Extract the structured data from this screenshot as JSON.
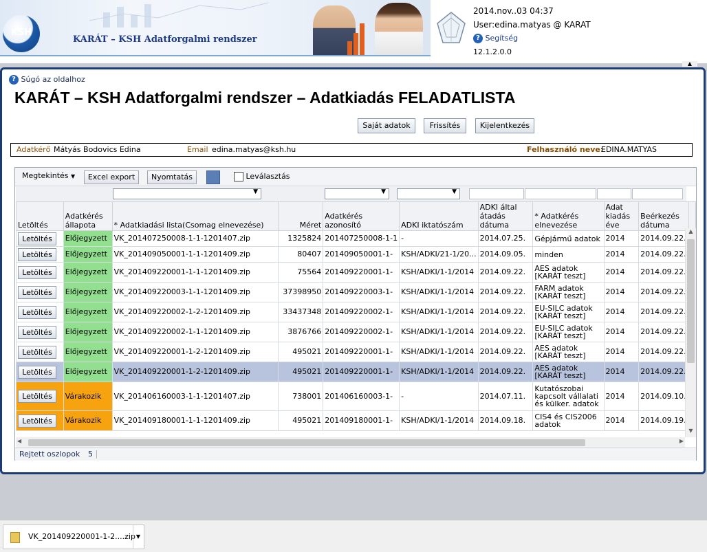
{
  "header": {
    "logo_text": "KSH",
    "banner_title": "KARÁT – KSH Adatforgalmi rendszer",
    "datetime": "2014.nov..03 04:37",
    "user": "User:edina.matyas @ KARAT",
    "help": "Segítség",
    "version": "12.1.2.0.0",
    "karat_logo_label": "KARÁT"
  },
  "page": {
    "help_link": "Súgó az oldalhoz",
    "title": "KARÁT – KSH Adatforgalmi rendszer – Adatkiadás FELADATLISTA",
    "buttons": {
      "own_data": "Saját adatok",
      "refresh": "Frissítés",
      "logout": "Kijelentkezés"
    }
  },
  "userinfo": {
    "requester_label": "Adatkérő",
    "requester": "Mátyás Bodovics Edina",
    "email_label": "Email",
    "email": "edina.matyas@ksh.hu",
    "username_label": "Felhasználó neve:",
    "username": "EDINA.MATYAS"
  },
  "grid": {
    "toolbar": {
      "view": "Megtekintés",
      "excel": "Excel export",
      "print": "Nyomtatás",
      "detach": "Leválasztás"
    },
    "columns": [
      "Letöltés",
      "Adatkérés állapota",
      "* Adatkiadási lista(Csomag elnevezése)",
      "Méret",
      "Adatkérés azonosító",
      "ADKI iktatószám",
      "ADKI által átadás dátuma",
      "* Adatkérés elnevezése",
      "Adat kiadás éve",
      "Beérkezés dátuma"
    ],
    "download_label": "Letöltés",
    "rows": [
      {
        "status": "Előjegyzett",
        "file": "VK_201407250008-1-1-1201407.zip",
        "size": "1325824",
        "req_id": "201407250008-1-1",
        "adki": "-",
        "handover": "2014.07.25.",
        "name": "Gépjármű adatok",
        "year": "2014",
        "arrival": "2014.09.22."
      },
      {
        "status": "Előjegyzett",
        "file": "VK_201409050001-1-1-1201409.zip",
        "size": "80407",
        "req_id": "201409050001-1-",
        "adki": "KSH/ADKI/21-1/20...",
        "handover": "2014.09.05.",
        "name": "minden",
        "year": "2014",
        "arrival": "2014.09.22."
      },
      {
        "status": "Előjegyzett",
        "file": "VK_201409220001-1-1-1201409.zip",
        "size": "75564",
        "req_id": "201409220001-1-",
        "adki": "KSH/ADKI/1-1/2014",
        "handover": "2014.09.22.",
        "name": "AES adatok [KARÁT teszt]",
        "year": "2014",
        "arrival": "2014.09.22."
      },
      {
        "status": "Előjegyzett",
        "file": "VK_201409220003-1-1-1201409.zip",
        "size": "37398950",
        "req_id": "201409220003-1-",
        "adki": "KSH/ADKI/1-1/2014",
        "handover": "2014.09.22.",
        "name": "FARM adatok [KARÁT teszt]",
        "year": "2014",
        "arrival": "2014.09.22."
      },
      {
        "status": "Előjegyzett",
        "file": "VK_201409220002-1-2-1201409.zip",
        "size": "33437348",
        "req_id": "201409220002-1-",
        "adki": "KSH/ADKI/1-1/2014",
        "handover": "2014.09.22.",
        "name": "EU-SILC adatok [KARÁT teszt]",
        "year": "2014",
        "arrival": "2014.09.22."
      },
      {
        "status": "Előjegyzett",
        "file": "VK_201409220002-1-1-1201409.zip",
        "size": "3876766",
        "req_id": "201409220002-1-",
        "adki": "KSH/ADKI/1-1/2014",
        "handover": "2014.09.22.",
        "name": "EU-SILC adatok [KARÁT teszt]",
        "year": "2014",
        "arrival": "2014.09.22."
      },
      {
        "status": "Előjegyzett",
        "file": "VK_201409220001-1-2-1201409.zip",
        "size": "495021",
        "req_id": "201409220001-1-",
        "adki": "KSH/ADKI/1-1/2014",
        "handover": "2014.09.22.",
        "name": "AES adatok [KARÁT teszt]",
        "year": "2014",
        "arrival": "2014.09.22."
      },
      {
        "status": "Előjegyzett",
        "file": "VK_201409220001-1-2-1201409.zip",
        "size": "495021",
        "req_id": "201409220001-1-",
        "adki": "KSH/ADKI/1-1/2014",
        "handover": "2014.09.22.",
        "name": "AES adatok [KARÁT teszt]",
        "year": "2014",
        "arrival": "2014.09.22.",
        "selected": true
      },
      {
        "status": "Várakozik",
        "file": "VK_201406160003-1-1-1201407.zip",
        "size": "738001",
        "req_id": "201406160003-1-",
        "adki": "-",
        "handover": "2014.07.11.",
        "name": "Kutatószobai kapcsolt vállalati és külker. adatok",
        "year": "2014",
        "arrival": "2014.09.10."
      },
      {
        "status": "Várakozik",
        "file": "VK_201409180001-1-1-1201409.zip",
        "size": "495021",
        "req_id": "201409180001-1-",
        "adki": "KSH/ADKI/1-1/2014",
        "handover": "2014.09.18.",
        "name": "CIS4 és CIS2006 adatok",
        "year": "2014",
        "arrival": "2014.09.19."
      }
    ],
    "footer": {
      "label": "Rejtett oszlopok",
      "count": "5"
    }
  },
  "download_bar": {
    "file": "VK_201409220001-1-2....zip"
  },
  "colors": {
    "pending": "#92e08f",
    "waiting": "#f7a20f",
    "selected": "#b8c4de",
    "frame": "#1b3a78"
  }
}
